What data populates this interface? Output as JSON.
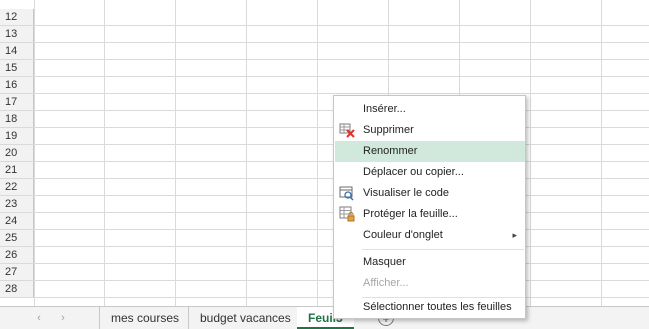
{
  "rows": [
    "12",
    "13",
    "14",
    "15",
    "16",
    "17",
    "18",
    "19",
    "20",
    "21",
    "22",
    "23",
    "24",
    "25",
    "26",
    "27",
    "28"
  ],
  "tabbar": {
    "prev_icon": "chevron-left-icon",
    "next_icon": "chevron-right-icon",
    "prev_arrow": "‹",
    "next_arrow": "›",
    "tabs": [
      {
        "label": "mes courses"
      },
      {
        "label": "budget vacances"
      },
      {
        "label": "Feuil3"
      }
    ],
    "add_sheet_icon": "plus-circle-icon",
    "add_sheet_glyph": "+"
  },
  "context_menu": {
    "items": [
      {
        "label": "Insérer...",
        "icon": ""
      },
      {
        "label": "Supprimer",
        "icon": "delete-sheet-icon"
      },
      {
        "label": "Renommer",
        "icon": "",
        "highlighted": true
      },
      {
        "label": "Déplacer ou copier...",
        "icon": ""
      },
      {
        "label": "Visualiser le code",
        "icon": "view-code-icon"
      },
      {
        "label": "Protéger la feuille...",
        "icon": "protect-sheet-icon"
      },
      {
        "label": "Couleur d'onglet",
        "icon": "",
        "submenu": true,
        "submenu_arrow": "▸"
      },
      {
        "label": "Masquer",
        "icon": ""
      },
      {
        "label": "Afficher...",
        "icon": "",
        "disabled": true
      },
      {
        "label": "Sélectionner toutes les feuilles",
        "icon": ""
      }
    ]
  },
  "colors": {
    "accent": "#217346",
    "highlight": "#d1e9dc",
    "delete_red": "#d9342b"
  }
}
